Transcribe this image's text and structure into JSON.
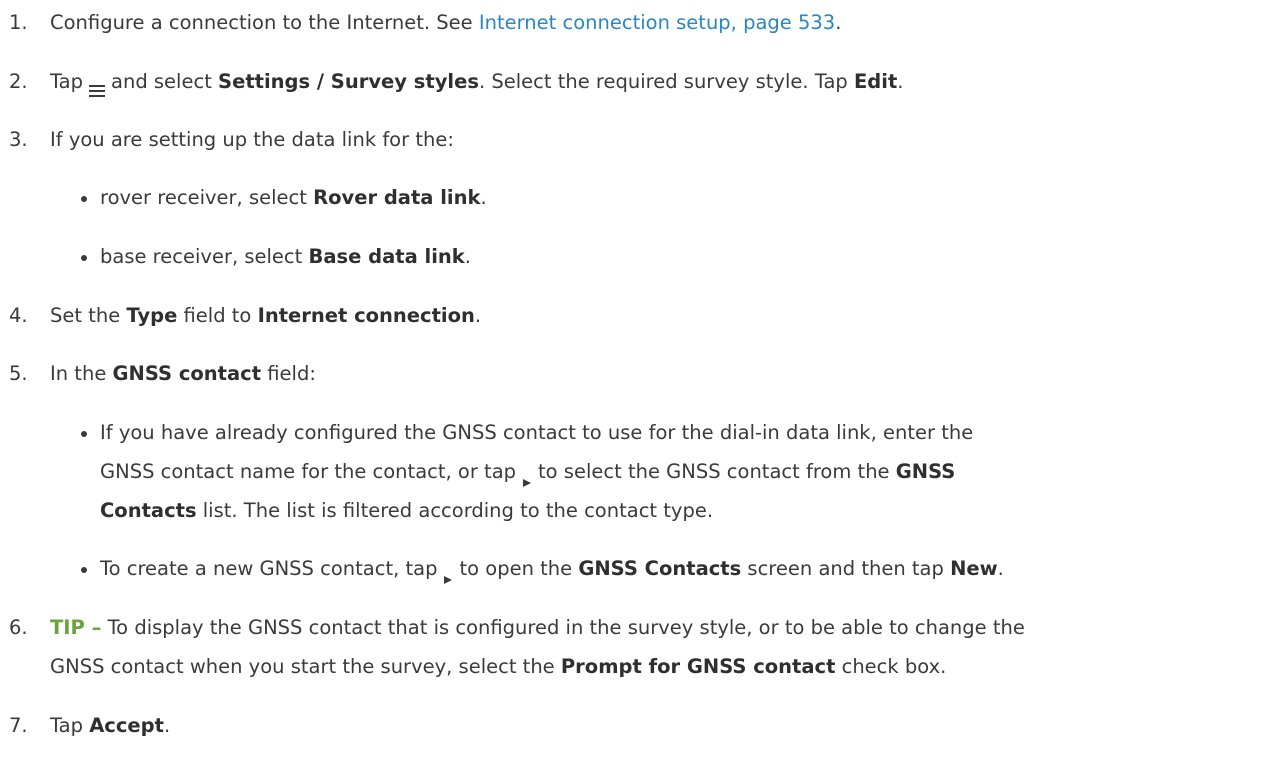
{
  "steps": {
    "s1": {
      "num": "1.",
      "text_a": "Configure a connection to the Internet. See ",
      "link": "Internet connection setup, page 533",
      "text_b": "."
    },
    "s2": {
      "num": "2.",
      "text_a": "Tap",
      "text_b": "and select ",
      "bold_a": "Settings",
      "text_c": " / ",
      "bold_b": "Survey styles",
      "text_d": ". Select the required survey style. Tap ",
      "bold_c": "Edit",
      "text_e": "."
    },
    "s3": {
      "num": "3.",
      "text": "If you are setting up the data link for the:",
      "bullet_1": {
        "text_a": "rover receiver, select ",
        "bold": "Rover data link",
        "text_b": "."
      },
      "bullet_2": {
        "text_a": "base receiver, select ",
        "bold": "Base data link",
        "text_b": "."
      }
    },
    "s4": {
      "num": "4.",
      "text_a": "Set the ",
      "bold_a": "Type",
      "text_b": " field to ",
      "bold_b": "Internet connection",
      "text_c": "."
    },
    "s5": {
      "num": "5.",
      "text_a": "In the ",
      "bold": "GNSS contact",
      "text_b": " field:",
      "bullet_1": {
        "line1": "If you have already configured the GNSS contact to use for the dial-in data link, enter the",
        "line2_a": "GNSS contact name for the contact, or tap",
        "line2_b": "to select the GNSS contact from the ",
        "line2_bold": "GNSS",
        "line3_bold": "Contacts",
        "line3_b": " list. The list is filtered according to the contact type."
      },
      "bullet_2": {
        "text_a": "To create a new GNSS contact, tap",
        "text_b": "to open the ",
        "bold_a": "GNSS Contacts",
        "text_c": " screen and then tap ",
        "bold_b": "New",
        "text_d": "."
      }
    },
    "s6": {
      "num": "6.",
      "tip": "TIP –",
      "line1": " To display the GNSS contact that is configured in the survey style, or to be able to change the",
      "line2_a": "GNSS contact when you start the survey, select the ",
      "line2_bold": "Prompt for GNSS contact",
      "line2_b": " check box."
    },
    "s7": {
      "num": "7.",
      "text_a": "Tap ",
      "bold": "Accept",
      "text_b": "."
    }
  },
  "icons": {
    "menu": "hamburger-menu-icon",
    "arrow": "right-triangle-arrow-icon"
  },
  "colors": {
    "text": "#3a3a3a",
    "link": "#2a86c3",
    "tip": "#6aa23c"
  }
}
